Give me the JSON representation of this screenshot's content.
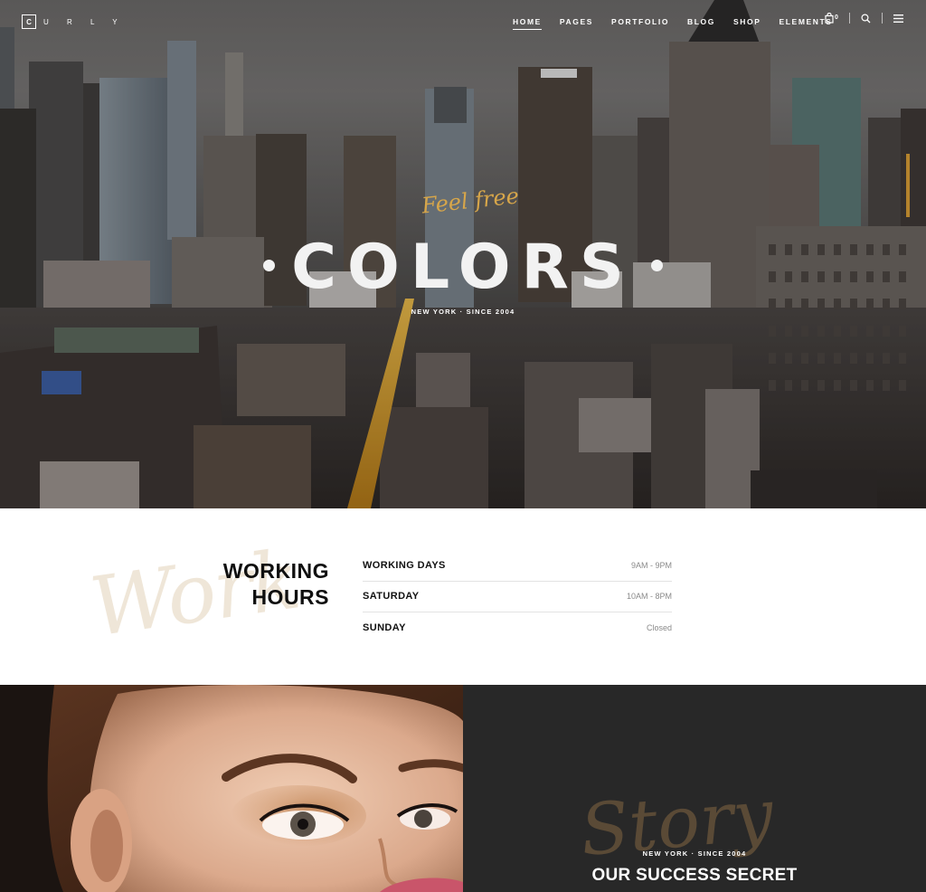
{
  "brand": {
    "logo_letter": "C",
    "logo_rest": "U R L Y"
  },
  "nav": {
    "items": [
      {
        "label": "HOME",
        "active": true
      },
      {
        "label": "PAGES"
      },
      {
        "label": "PORTFOLIO"
      },
      {
        "label": "BLOG"
      },
      {
        "label": "SHOP"
      },
      {
        "label": "ELEMENTS"
      }
    ],
    "cart_count": "0"
  },
  "hero": {
    "script": "Feel free",
    "title": "COLORS",
    "subtitle": "NEW YORK · SINCE 2004"
  },
  "hours": {
    "script": "Work",
    "title_line1": "WORKING",
    "title_line2": "HOURS",
    "rows": [
      {
        "day": "WORKING DAYS",
        "time": "9AM - 9PM"
      },
      {
        "day": "SATURDAY",
        "time": "10AM - 8PM"
      },
      {
        "day": "SUNDAY",
        "time": "Closed"
      }
    ]
  },
  "story": {
    "script": "Story",
    "subtitle": "NEW YORK · SINCE 2004",
    "title": "OUR SUCCESS SECRET"
  },
  "colors": {
    "accent": "#d7a64a",
    "dark_panel": "#282828"
  }
}
